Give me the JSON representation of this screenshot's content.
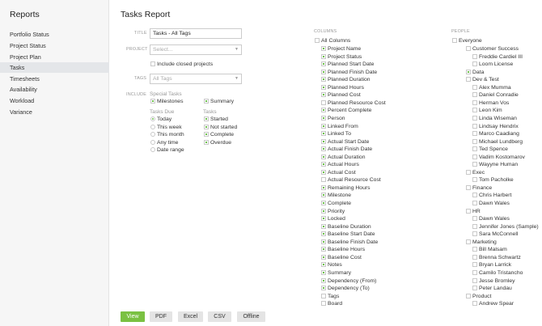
{
  "sidebar": {
    "title": "Reports",
    "items": [
      {
        "label": "Portfolio Status",
        "active": false
      },
      {
        "label": "Project Status",
        "active": false
      },
      {
        "label": "Project Plan",
        "active": false
      },
      {
        "label": "Tasks",
        "active": true
      },
      {
        "label": "Timesheets",
        "active": false
      },
      {
        "label": "Availability",
        "active": false
      },
      {
        "label": "Workload",
        "active": false
      },
      {
        "label": "Variance",
        "active": false
      }
    ]
  },
  "main": {
    "title": "Tasks Report",
    "title_label": "TITLE",
    "title_value": "Tasks - All Tags",
    "project_label": "PROJECT",
    "project_placeholder": "Select...",
    "include_closed_label": "Include closed projects",
    "tags_label": "TAGS",
    "tags_placeholder": "All Tags",
    "include_label": "INCLUDE",
    "special_tasks_label": "Special Tasks",
    "milestones_label": "Milestones",
    "summary_label": "Summary",
    "tasks_due_label": "Tasks Due",
    "tasks_label": "Tasks",
    "due_options": [
      {
        "label": "Today",
        "selected": true
      },
      {
        "label": "This week",
        "selected": false
      },
      {
        "label": "This month",
        "selected": false
      },
      {
        "label": "Any time",
        "selected": false
      },
      {
        "label": "Date range",
        "selected": false
      }
    ],
    "task_options": [
      {
        "label": "Started",
        "checked": true
      },
      {
        "label": "Not started",
        "checked": true
      },
      {
        "label": "Complete",
        "checked": true
      },
      {
        "label": "Overdue",
        "checked": true
      }
    ]
  },
  "columns": {
    "label": "COLUMNS",
    "all_label": "All Columns",
    "items": [
      {
        "label": "Project Name",
        "checked": true
      },
      {
        "label": "Project Status",
        "checked": true
      },
      {
        "label": "Planned Start Date",
        "checked": true
      },
      {
        "label": "Planned Finish Date",
        "checked": true
      },
      {
        "label": "Planned Duration",
        "checked": true
      },
      {
        "label": "Planned Hours",
        "checked": true
      },
      {
        "label": "Planned Cost",
        "checked": true
      },
      {
        "label": "Planned Resource Cost",
        "checked": false
      },
      {
        "label": "Percent Complete",
        "checked": true
      },
      {
        "label": "Person",
        "checked": true
      },
      {
        "label": "Linked From",
        "checked": true
      },
      {
        "label": "Linked To",
        "checked": true
      },
      {
        "label": "Actual Start Date",
        "checked": true
      },
      {
        "label": "Actual Finish Date",
        "checked": true
      },
      {
        "label": "Actual Duration",
        "checked": true
      },
      {
        "label": "Actual Hours",
        "checked": true
      },
      {
        "label": "Actual Cost",
        "checked": true
      },
      {
        "label": "Actual Resource Cost",
        "checked": false
      },
      {
        "label": "Remaining Hours",
        "checked": true
      },
      {
        "label": "Milestone",
        "checked": true
      },
      {
        "label": "Complete",
        "checked": true
      },
      {
        "label": "Priority",
        "checked": true
      },
      {
        "label": "Locked",
        "checked": true
      },
      {
        "label": "Baseline Duration",
        "checked": true
      },
      {
        "label": "Baseline Start Date",
        "checked": true
      },
      {
        "label": "Baseline Finish Date",
        "checked": true
      },
      {
        "label": "Baseline Hours",
        "checked": true
      },
      {
        "label": "Baseline Cost",
        "checked": true
      },
      {
        "label": "Notes",
        "checked": true
      },
      {
        "label": "Summary",
        "checked": true
      },
      {
        "label": "Dependency (From)",
        "checked": true
      },
      {
        "label": "Dependency (To)",
        "checked": true
      },
      {
        "label": "Tags",
        "checked": false
      },
      {
        "label": "Board",
        "checked": false
      }
    ]
  },
  "people": {
    "label": "PEOPLE",
    "all_label": "Everyone",
    "items": [
      {
        "label": "Customer Success",
        "level": 1,
        "checked": false
      },
      {
        "label": "Freddie Cardiel III",
        "level": 2,
        "checked": false
      },
      {
        "label": "Loom License",
        "level": 2,
        "checked": false
      },
      {
        "label": "Data",
        "level": 1,
        "checked": true
      },
      {
        "label": "Dev & Test",
        "level": 1,
        "checked": false
      },
      {
        "label": "Alex Mumma",
        "level": 2,
        "checked": false
      },
      {
        "label": "Daniel Conradie",
        "level": 2,
        "checked": false
      },
      {
        "label": "Herman Vos",
        "level": 2,
        "checked": false
      },
      {
        "label": "Leon Kim",
        "level": 2,
        "checked": false
      },
      {
        "label": "Linda Wiseman",
        "level": 2,
        "checked": false
      },
      {
        "label": "Lindsay Hendrix",
        "level": 2,
        "checked": false
      },
      {
        "label": "Marco Caadiang",
        "level": 2,
        "checked": false
      },
      {
        "label": "Michael Lundberg",
        "level": 2,
        "checked": false
      },
      {
        "label": "Ted Spence",
        "level": 2,
        "checked": false
      },
      {
        "label": "Vadim Kostomarov",
        "level": 2,
        "checked": false
      },
      {
        "label": "Wayyne Human",
        "level": 2,
        "checked": false
      },
      {
        "label": "Exec",
        "level": 1,
        "checked": false
      },
      {
        "label": "Tom Pacholke",
        "level": 2,
        "checked": false
      },
      {
        "label": "Finance",
        "level": 1,
        "checked": false
      },
      {
        "label": "Chris Harbert",
        "level": 2,
        "checked": false
      },
      {
        "label": "Dawn Wales",
        "level": 2,
        "checked": false
      },
      {
        "label": "HR",
        "level": 1,
        "checked": false
      },
      {
        "label": "Dawn Wales",
        "level": 2,
        "checked": false
      },
      {
        "label": "Jennifer Jones (Sample)",
        "level": 2,
        "checked": false
      },
      {
        "label": "Sara McConnell",
        "level": 2,
        "checked": false
      },
      {
        "label": "Marketing",
        "level": 1,
        "checked": false
      },
      {
        "label": "Bill Malsam",
        "level": 2,
        "checked": false
      },
      {
        "label": "Brenna Schwartz",
        "level": 2,
        "checked": false
      },
      {
        "label": "Bryan Larrick",
        "level": 2,
        "checked": false
      },
      {
        "label": "Camilo Tristancho",
        "level": 2,
        "checked": false
      },
      {
        "label": "Jesse Bromley",
        "level": 2,
        "checked": false
      },
      {
        "label": "Peter Landau",
        "level": 2,
        "checked": false
      },
      {
        "label": "Product",
        "level": 1,
        "checked": false
      },
      {
        "label": "Andrew Spear",
        "level": 2,
        "checked": false
      }
    ]
  },
  "buttons": {
    "view": "View",
    "pdf": "PDF",
    "excel": "Excel",
    "csv": "CSV",
    "offline": "Offline"
  },
  "colors": {
    "accent": "#7ac142",
    "check": "#6cc04a",
    "sidebar_bg": "#f6f6f6",
    "active_bg": "#e4e6e9"
  }
}
